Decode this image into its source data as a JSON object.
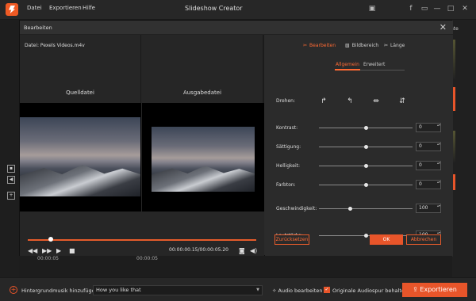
{
  "app": {
    "title": "Slideshow Creator",
    "menu": [
      "Datei",
      "Exportieren",
      "Hilfe"
    ]
  },
  "titlebar_icons": [
    "cart-icon",
    "facebook-icon",
    "feedback-icon",
    "minimize-icon",
    "maximize-icon",
    "close-icon"
  ],
  "right_tab": "nte",
  "dialog": {
    "title": "Bearbeiten",
    "file_label": "Datei: Pexels Videos.m4v",
    "source_label": "Quelldatei",
    "output_label": "Ausgabedatei",
    "time": "00:00:00.15/00:00:05.20",
    "progress": 0.1,
    "tabs": [
      {
        "icon": "crop-icon",
        "label": "Bearbeiten"
      },
      {
        "icon": "image-area-icon",
        "label": "Bildbereich"
      },
      {
        "icon": "length-icon",
        "label": "Länge"
      }
    ],
    "subtabs": [
      "Allgemein",
      "Erweitert"
    ],
    "rotate_label": "Drehen:",
    "sliders": [
      {
        "label": "Kontrast:",
        "value": "0",
        "pos": 0.5
      },
      {
        "label": "Sättigung:",
        "value": "0",
        "pos": 0.5
      },
      {
        "label": "Helligkeit:",
        "value": "0",
        "pos": 0.5
      },
      {
        "label": "Farbton:",
        "value": "0",
        "pos": 0.5
      },
      {
        "label": "Geschwindigkeit:",
        "value": "100",
        "pos": 0.33
      },
      {
        "label": "Lautstärke:",
        "value": "100",
        "pos": 0.5
      }
    ],
    "reset": "Zurücksetzen",
    "ok": "OK",
    "cancel": "Abbrechen"
  },
  "timeline": {
    "times": [
      "00:00:05",
      "00:00:05"
    ]
  },
  "bottom": {
    "music_label": "Hintergrundmusik hinzufügen:",
    "music_value": "How you like that",
    "audio_edit": "Audio bearbeiten",
    "keep_audio": "Originale Audiospur behalten",
    "export": "Exportieren"
  },
  "colors": {
    "accent": "#e8552a"
  }
}
